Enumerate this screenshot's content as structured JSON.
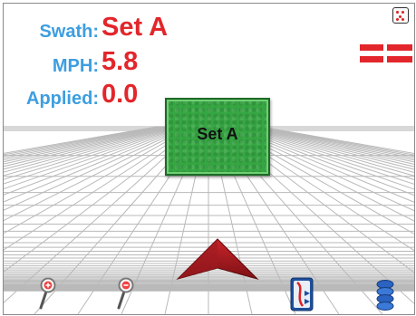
{
  "readout": {
    "swath_label": "Swath:",
    "swath_value": "Set A",
    "mph_label": "MPH:",
    "mph_value": "5.8",
    "applied_label": "Applied:",
    "applied_value": "0.0"
  },
  "map": {
    "boundary_label": "Set A"
  },
  "toolbar": {
    "icons": [
      "zoom-in-icon",
      "zoom-out-icon",
      "steering-icon",
      "layers-icon",
      "grid-view-icon"
    ]
  },
  "colors": {
    "label": "#3d9ee0",
    "value": "#e2262b",
    "boundary_fill": "#36a643",
    "vehicle": "#a0171c"
  }
}
